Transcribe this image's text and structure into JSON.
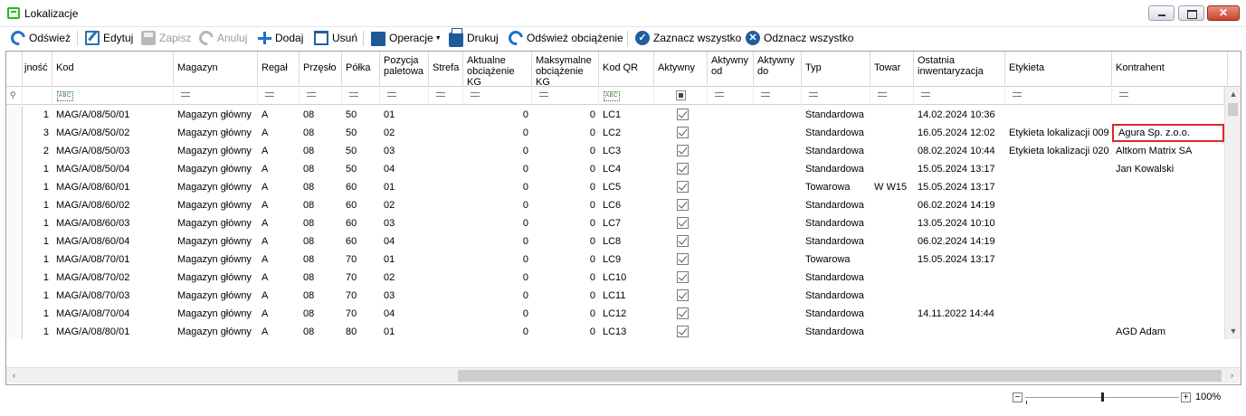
{
  "window": {
    "title": "Lokalizacje",
    "controls": [
      "minimize",
      "maximize",
      "close"
    ],
    "close_glyph": "✕"
  },
  "toolbar": {
    "refresh": "Odśwież",
    "edit": "Edytuj",
    "save": "Zapisz",
    "cancel": "Anuluj",
    "add": "Dodaj",
    "delete": "Usuń",
    "operations": "Operacje",
    "print": "Drukuj",
    "refresh_load": "Odśwież obciążenie",
    "select_all": "Zaznacz wszystko",
    "deselect_all": "Odznacz wszystko"
  },
  "columns": [
    "jność",
    "Kod",
    "Magazyn",
    "Regał",
    "Przęsło",
    "Półka",
    "Pozycja paletowa",
    "Strefa",
    "Aktualne obciążenie KG",
    "Maksymalne obciążenie KG",
    "Kod QR",
    "Aktywny",
    "Aktywny od",
    "Aktywny do",
    "Typ",
    "Towar",
    "Ostatnia inwentaryzacja",
    "Etykieta",
    "Kontrahent"
  ],
  "rows": [
    {
      "qty": "1",
      "kod": "MAG/A/08/50/01",
      "magazyn": "Magazyn główny",
      "regal": "A",
      "przeslo": "08",
      "polka": "50",
      "pozycja": "01",
      "strefa": "",
      "akt_obc": "0",
      "max_obc": "0",
      "qr": "LC1",
      "aktywny": true,
      "od": "",
      "do": "",
      "typ": "Standardowa",
      "towar": "",
      "inwent": "14.02.2024 10:36",
      "etykieta": "",
      "kontrahent": ""
    },
    {
      "qty": "3",
      "kod": "MAG/A/08/50/02",
      "magazyn": "Magazyn główny",
      "regal": "A",
      "przeslo": "08",
      "polka": "50",
      "pozycja": "02",
      "strefa": "",
      "akt_obc": "0",
      "max_obc": "0",
      "qr": "LC2",
      "aktywny": true,
      "od": "",
      "do": "",
      "typ": "Standardowa",
      "towar": "",
      "inwent": "16.05.2024 12:02",
      "etykieta": "Etykieta lokalizacji 009",
      "kontrahent": "Agura Sp. z.o.o."
    },
    {
      "qty": "2",
      "kod": "MAG/A/08/50/03",
      "magazyn": "Magazyn główny",
      "regal": "A",
      "przeslo": "08",
      "polka": "50",
      "pozycja": "03",
      "strefa": "",
      "akt_obc": "0",
      "max_obc": "0",
      "qr": "LC3",
      "aktywny": true,
      "od": "",
      "do": "",
      "typ": "Standardowa",
      "towar": "",
      "inwent": "08.02.2024 10:44",
      "etykieta": "Etykieta lokalizacji 020",
      "kontrahent": "Altkom Matrix SA"
    },
    {
      "qty": "1",
      "kod": "MAG/A/08/50/04",
      "magazyn": "Magazyn główny",
      "regal": "A",
      "przeslo": "08",
      "polka": "50",
      "pozycja": "04",
      "strefa": "",
      "akt_obc": "0",
      "max_obc": "0",
      "qr": "LC4",
      "aktywny": true,
      "od": "",
      "do": "",
      "typ": "Standardowa",
      "towar": "",
      "inwent": "15.05.2024 13:17",
      "etykieta": "",
      "kontrahent": "Jan Kowalski"
    },
    {
      "qty": "1",
      "kod": "MAG/A/08/60/01",
      "magazyn": "Magazyn główny",
      "regal": "A",
      "przeslo": "08",
      "polka": "60",
      "pozycja": "01",
      "strefa": "",
      "akt_obc": "0",
      "max_obc": "0",
      "qr": "LC5",
      "aktywny": true,
      "od": "",
      "do": "",
      "typ": "Towarowa",
      "towar": "W W15",
      "inwent": "15.05.2024 13:17",
      "etykieta": "",
      "kontrahent": ""
    },
    {
      "qty": "1",
      "kod": "MAG/A/08/60/02",
      "magazyn": "Magazyn główny",
      "regal": "A",
      "przeslo": "08",
      "polka": "60",
      "pozycja": "02",
      "strefa": "",
      "akt_obc": "0",
      "max_obc": "0",
      "qr": "LC6",
      "aktywny": true,
      "od": "",
      "do": "",
      "typ": "Standardowa",
      "towar": "",
      "inwent": "06.02.2024 14:19",
      "etykieta": "",
      "kontrahent": ""
    },
    {
      "qty": "1",
      "kod": "MAG/A/08/60/03",
      "magazyn": "Magazyn główny",
      "regal": "A",
      "przeslo": "08",
      "polka": "60",
      "pozycja": "03",
      "strefa": "",
      "akt_obc": "0",
      "max_obc": "0",
      "qr": "LC7",
      "aktywny": true,
      "od": "",
      "do": "",
      "typ": "Standardowa",
      "towar": "",
      "inwent": "13.05.2024 10:10",
      "etykieta": "",
      "kontrahent": ""
    },
    {
      "qty": "1",
      "kod": "MAG/A/08/60/04",
      "magazyn": "Magazyn główny",
      "regal": "A",
      "przeslo": "08",
      "polka": "60",
      "pozycja": "04",
      "strefa": "",
      "akt_obc": "0",
      "max_obc": "0",
      "qr": "LC8",
      "aktywny": true,
      "od": "",
      "do": "",
      "typ": "Standardowa",
      "towar": "",
      "inwent": "06.02.2024 14:19",
      "etykieta": "",
      "kontrahent": ""
    },
    {
      "qty": "1",
      "kod": "MAG/A/08/70/01",
      "magazyn": "Magazyn główny",
      "regal": "A",
      "przeslo": "08",
      "polka": "70",
      "pozycja": "01",
      "strefa": "",
      "akt_obc": "0",
      "max_obc": "0",
      "qr": "LC9",
      "aktywny": true,
      "od": "",
      "do": "",
      "typ": "Towarowa",
      "towar": "",
      "inwent": "15.05.2024 13:17",
      "etykieta": "",
      "kontrahent": ""
    },
    {
      "qty": "1",
      "kod": "MAG/A/08/70/02",
      "magazyn": "Magazyn główny",
      "regal": "A",
      "przeslo": "08",
      "polka": "70",
      "pozycja": "02",
      "strefa": "",
      "akt_obc": "0",
      "max_obc": "0",
      "qr": "LC10",
      "aktywny": true,
      "od": "",
      "do": "",
      "typ": "Standardowa",
      "towar": "",
      "inwent": "",
      "etykieta": "",
      "kontrahent": ""
    },
    {
      "qty": "1",
      "kod": "MAG/A/08/70/03",
      "magazyn": "Magazyn główny",
      "regal": "A",
      "przeslo": "08",
      "polka": "70",
      "pozycja": "03",
      "strefa": "",
      "akt_obc": "0",
      "max_obc": "0",
      "qr": "LC11",
      "aktywny": true,
      "od": "",
      "do": "",
      "typ": "Standardowa",
      "towar": "",
      "inwent": "",
      "etykieta": "",
      "kontrahent": ""
    },
    {
      "qty": "1",
      "kod": "MAG/A/08/70/04",
      "magazyn": "Magazyn główny",
      "regal": "A",
      "przeslo": "08",
      "polka": "70",
      "pozycja": "04",
      "strefa": "",
      "akt_obc": "0",
      "max_obc": "0",
      "qr": "LC12",
      "aktywny": true,
      "od": "",
      "do": "",
      "typ": "Standardowa",
      "towar": "",
      "inwent": "14.11.2022 14:44",
      "etykieta": "",
      "kontrahent": ""
    },
    {
      "qty": "1",
      "kod": "MAG/A/08/80/01",
      "magazyn": "Magazyn główny",
      "regal": "A",
      "przeslo": "08",
      "polka": "80",
      "pozycja": "01",
      "strefa": "",
      "akt_obc": "0",
      "max_obc": "0",
      "qr": "LC13",
      "aktywny": true,
      "od": "",
      "do": "",
      "typ": "Standardowa",
      "towar": "",
      "inwent": "",
      "etykieta": "",
      "kontrahent": "AGD Adam"
    }
  ],
  "focused_cell": {
    "row": 1,
    "column": "Kontrahent"
  },
  "zoom": {
    "label": "100%",
    "minus": "−",
    "plus": "+"
  },
  "colors": {
    "accent": "#1e72c8",
    "focus": "#e0262b"
  }
}
